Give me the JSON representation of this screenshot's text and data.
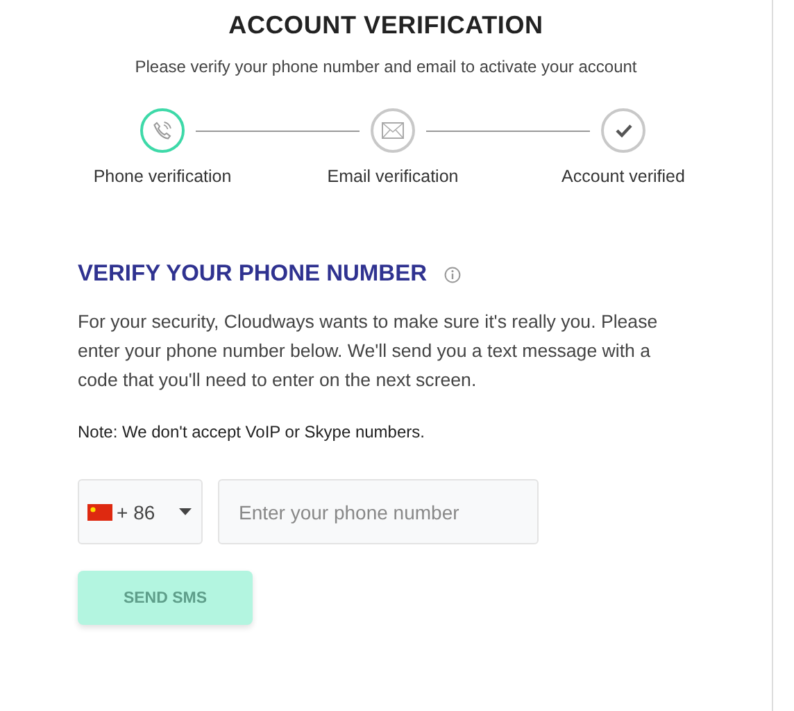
{
  "title": "ACCOUNT VERIFICATION",
  "subtitle": "Please verify your phone number and email to activate your account",
  "steps": [
    {
      "kind": "phone",
      "label": "Phone verification",
      "selected": true
    },
    {
      "kind": "email",
      "label": "Email verification",
      "selected": false
    },
    {
      "kind": "check",
      "label": "Account verified",
      "selected": false
    }
  ],
  "section": {
    "heading": "VERIFY YOUR PHONE NUMBER",
    "description": "For your security, Cloudways wants to make sure it's really you. Please enter your phone number below. We'll send you a text message with a code that you'll need to enter on the next screen.",
    "note": "Note: We don't accept VoIP or Skype numbers."
  },
  "country_code": "+ 86",
  "phone": {
    "placeholder": "Enter your phone number"
  },
  "send_button": {
    "label": "SEND SMS",
    "disabled": true
  }
}
